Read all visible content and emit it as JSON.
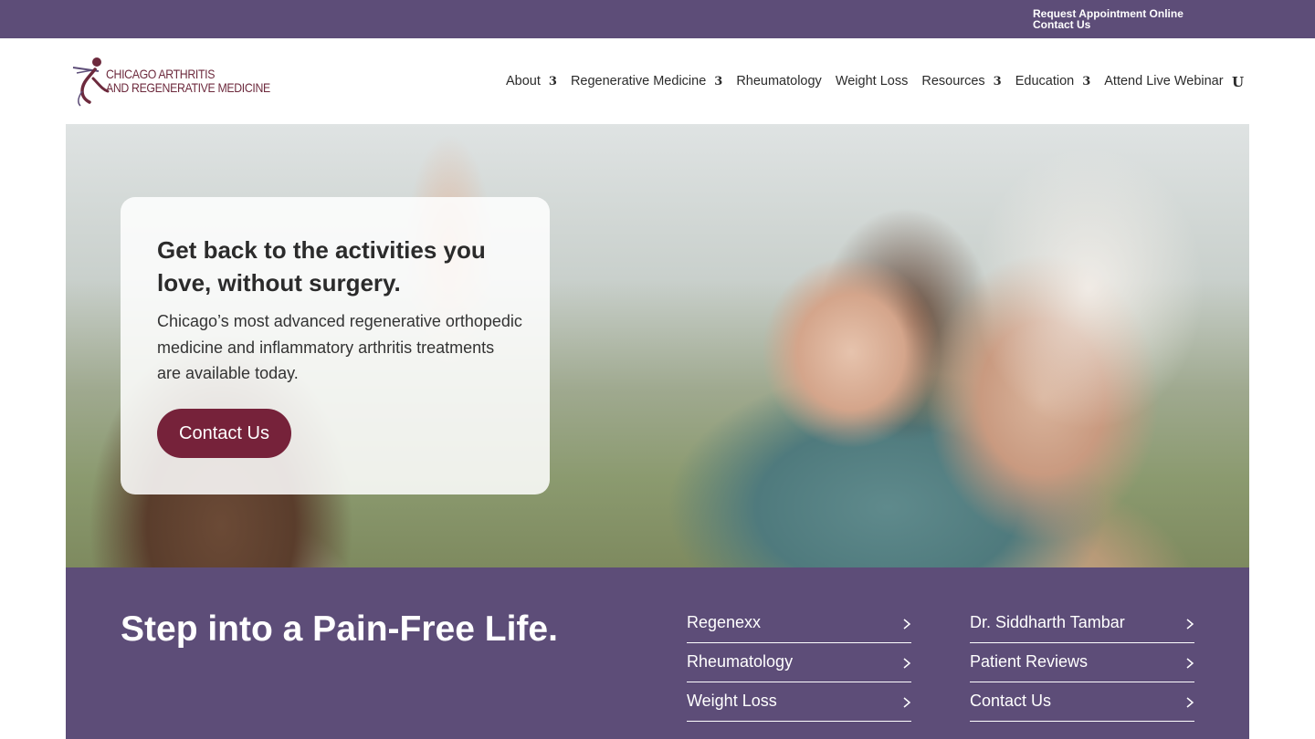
{
  "topbar": {
    "links": [
      "Request Appointment Online",
      "Contact Us"
    ]
  },
  "logo": {
    "line1": "CHICAGO ARTHRITIS",
    "line2": "AND REGENERATIVE MEDICINE"
  },
  "nav": {
    "items": [
      {
        "label": "About",
        "has_dropdown": true,
        "caret": "3"
      },
      {
        "label": "Regenerative Medicine",
        "has_dropdown": true,
        "caret": "3"
      },
      {
        "label": "Rheumatology",
        "has_dropdown": false
      },
      {
        "label": "Weight Loss",
        "has_dropdown": false
      },
      {
        "label": "Resources",
        "has_dropdown": true,
        "caret": "3"
      },
      {
        "label": "Education",
        "has_dropdown": true,
        "caret": "3"
      },
      {
        "label": "Attend Live Webinar",
        "has_dropdown": false
      }
    ],
    "search_glyph": "U"
  },
  "hero": {
    "title": "Get back to the activities you love, without surgery.",
    "subtitle": "Chicago’s most advanced regenerative orthopedic medicine and inflammatory arthritis treatments are available today.",
    "cta_label": "Contact Us"
  },
  "band": {
    "title": "Step into a Pain-Free Life.",
    "column1": [
      "Regenexx",
      "Rheumatology",
      "Weight Loss"
    ],
    "column2": [
      "Dr. Siddharth Tambar",
      "Patient Reviews",
      "Contact Us"
    ]
  },
  "colors": {
    "brand_purple": "#5d4d78",
    "brand_maroon": "#76223a",
    "text_dark": "#2b2b2b",
    "white": "#ffffff"
  },
  "icons": {
    "nav_caret": "chevron-down-icon",
    "search": "search-icon",
    "link_arrow": "chevron-right-icon"
  }
}
